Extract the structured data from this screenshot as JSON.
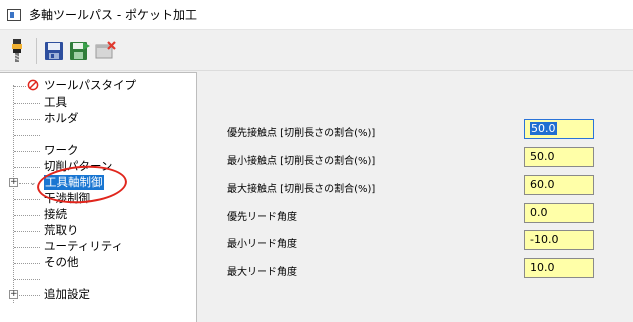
{
  "window": {
    "title": "多軸ツールパス - ポケット加工"
  },
  "toolbar": {
    "icons": [
      "tool-icon",
      "save-icon",
      "save-all-icon",
      "close-doc-icon"
    ]
  },
  "tree": {
    "items": [
      {
        "label": "ツールパスタイプ",
        "icon": "no-entry-icon"
      },
      {
        "label": "工具"
      },
      {
        "label": "ホルダ"
      },
      {
        "label": ""
      },
      {
        "label": "ワーク"
      },
      {
        "label": "切削パターン"
      },
      {
        "label": "工具軸制御",
        "selected": true
      },
      {
        "label": "干渉制御"
      },
      {
        "label": "接続"
      },
      {
        "label": "荒取り"
      },
      {
        "label": "ユーティリティ"
      },
      {
        "label": "その他"
      },
      {
        "label": ""
      },
      {
        "label": "追加設定"
      }
    ]
  },
  "params": [
    {
      "label": "優先接触点 [切削長さの割合(%)]",
      "value": "50.0"
    },
    {
      "label": "最小接触点 [切削長さの割合(%)]",
      "value": "50.0"
    },
    {
      "label": "最大接触点 [切削長さの割合(%)]",
      "value": "60.0"
    },
    {
      "label": "優先リード角度",
      "value": "0.0"
    },
    {
      "label": "最小リード角度",
      "value": "-10.0"
    },
    {
      "label": "最大リード角度",
      "value": "10.0"
    }
  ],
  "colors": {
    "selection": "#1976d2",
    "input_bg": "#ffffa8",
    "annotation": "#e0261d"
  }
}
